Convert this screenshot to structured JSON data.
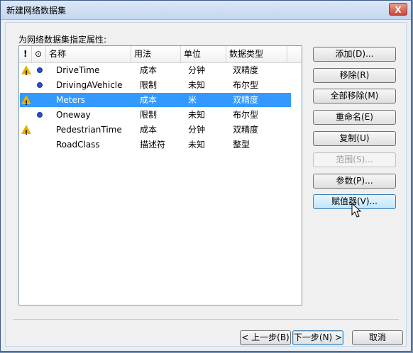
{
  "window": {
    "title": "新建网络数据集",
    "close_label": "X"
  },
  "prompt": "为网络数据集指定属性:",
  "list": {
    "headers": {
      "warn": "!",
      "info": "⊙",
      "name": "名称",
      "usage": "用法",
      "unit": "单位",
      "type": "数据类型"
    },
    "rows": [
      {
        "name": "DriveTime",
        "usage": "成本",
        "unit": "分钟",
        "type": "双精度",
        "warning": true,
        "blue": true,
        "selected": false
      },
      {
        "name": "DrivingAVehicle",
        "usage": "限制",
        "unit": "未知",
        "type": "布尔型",
        "warning": false,
        "blue": true,
        "selected": false
      },
      {
        "name": "Meters",
        "usage": "成本",
        "unit": "米",
        "type": "双精度",
        "warning": true,
        "blue": false,
        "selected": true
      },
      {
        "name": "Oneway",
        "usage": "限制",
        "unit": "未知",
        "type": "布尔型",
        "warning": false,
        "blue": true,
        "selected": false
      },
      {
        "name": "PedestrianTime",
        "usage": "成本",
        "unit": "分钟",
        "type": "双精度",
        "warning": true,
        "blue": false,
        "selected": false
      },
      {
        "name": "RoadClass",
        "usage": "描述符",
        "unit": "未知",
        "type": "整型",
        "warning": false,
        "blue": false,
        "selected": false
      }
    ]
  },
  "buttons": {
    "add": "添加(D)...",
    "remove": "移除(R)",
    "remove_all": "全部移除(M)",
    "rename": "重命名(E)",
    "copy": "复制(U)",
    "range": "范围(S)...",
    "params": "参数(P)...",
    "evaluators": "赋值器(V)...",
    "back": "< 上一步(B)",
    "next": "下一步(N) >",
    "cancel": "取消"
  }
}
